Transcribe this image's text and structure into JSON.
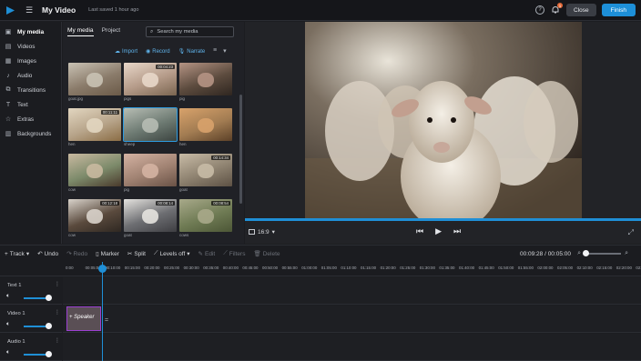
{
  "header": {
    "title": "My Video",
    "saved": "Last saved 1 hour ago",
    "close": "Close",
    "finish": "Finish",
    "notification_count": "1"
  },
  "sidebar": {
    "items": [
      {
        "label": "My media",
        "icon": "folder-icon"
      },
      {
        "label": "Videos",
        "icon": "film-icon"
      },
      {
        "label": "Images",
        "icon": "image-icon"
      },
      {
        "label": "Audio",
        "icon": "music-icon"
      },
      {
        "label": "Transitions",
        "icon": "transition-icon"
      },
      {
        "label": "Text",
        "icon": "text-icon"
      },
      {
        "label": "Extras",
        "icon": "star-icon"
      },
      {
        "label": "Backgrounds",
        "icon": "background-icon"
      }
    ]
  },
  "media": {
    "tabs": [
      "My media",
      "Project"
    ],
    "search_placeholder": "Search my media",
    "actions": {
      "import": "Import",
      "record": "Record",
      "narrate": "Narrate"
    },
    "thumbs": [
      {
        "dur": "",
        "cap": "goat.jpg",
        "colors": [
          "#8a7b6a",
          "#c9c2b4",
          "#6b5a48"
        ]
      },
      {
        "dur": "00:04:23",
        "cap": "pigs",
        "colors": [
          "#b49a88",
          "#e8d7c9",
          "#7a6550"
        ]
      },
      {
        "dur": "",
        "cap": "pig",
        "colors": [
          "#5c4b3e",
          "#b59484",
          "#2f2620"
        ]
      },
      {
        "dur": "00:11:11",
        "cap": "hen",
        "colors": [
          "#b7a48a",
          "#e2d6c0",
          "#8b6d45"
        ]
      },
      {
        "dur": "",
        "cap": "sheep",
        "colors": [
          "#6d7a72",
          "#b7bdb4",
          "#3c4440"
        ]
      },
      {
        "dur": "",
        "cap": "hen",
        "colors": [
          "#a27c52",
          "#d8a26b",
          "#5c4128"
        ]
      },
      {
        "dur": "",
        "cap": "cow",
        "colors": [
          "#7c8a6a",
          "#c9b9a0",
          "#4a3a2c"
        ]
      },
      {
        "dur": "",
        "cap": "pig",
        "colors": [
          "#a08272",
          "#d4b2a2",
          "#6a5246"
        ]
      },
      {
        "dur": "00:14:34",
        "cap": "goat",
        "colors": [
          "#8e8270",
          "#c8bba6",
          "#5d5144"
        ]
      },
      {
        "dur": "00:12:18",
        "cap": "cow",
        "colors": [
          "#5a4a3d",
          "#d9d3cb",
          "#2f2822"
        ]
      },
      {
        "dur": "00:08:14",
        "cap": "goat",
        "colors": [
          "#6d6e72",
          "#e5e3df",
          "#3e3e42"
        ]
      },
      {
        "dur": "00:08:54",
        "cap": "cows",
        "colors": [
          "#6f7b54",
          "#a8a98a",
          "#4c5636"
        ]
      }
    ]
  },
  "preview": {
    "ratio": "16:9"
  },
  "toolbar": {
    "track": "Track",
    "undo": "Undo",
    "redo": "Redo",
    "marker": "Marker",
    "split": "Split",
    "levels": "Levels off",
    "edit": "Edit",
    "filters": "Filters",
    "delete": "Delete",
    "timecode": "00:09:28 / 00:05:00"
  },
  "ruler": [
    "0:00",
    "00:05:00",
    "00:10:00",
    "00:15:00",
    "00:20:00",
    "00:25:00",
    "00:30:00",
    "00:35:00",
    "00:40:00",
    "00:45:00",
    "00:50:00",
    "00:55:00",
    "01:00:00",
    "01:05:00",
    "01:10:00",
    "01:15:00",
    "01:20:00",
    "01:25:00",
    "01:30:00",
    "01:35:00",
    "01:40:00",
    "01:45:00",
    "01:50:00",
    "01:55:00",
    "02:00:00",
    "02:05:00",
    "02:10:00",
    "02:15:00",
    "02:20:00",
    "02:25:00"
  ],
  "tracks": [
    {
      "name": "Text 1"
    },
    {
      "name": "Video 1"
    },
    {
      "name": "Audio 1"
    }
  ],
  "clip": {
    "label": "+ Speaker"
  }
}
